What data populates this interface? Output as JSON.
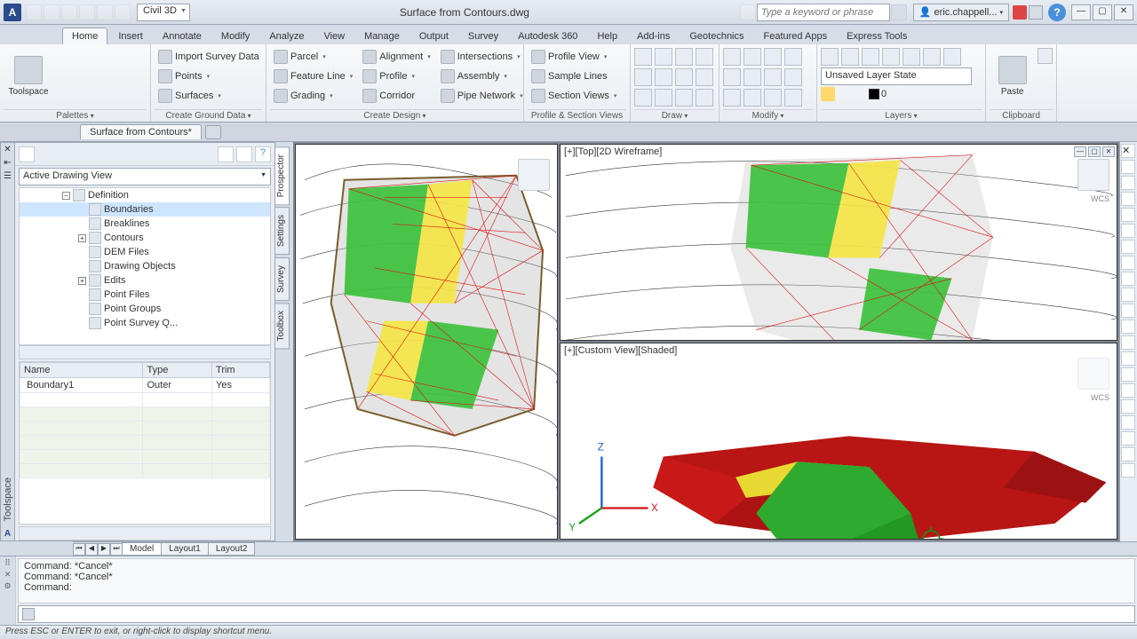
{
  "app": {
    "icon_letter": "A",
    "workspace": "Civil 3D",
    "title": "Surface from Contours.dwg",
    "search_placeholder": "Type a keyword or phrase",
    "user": "eric.chappell..."
  },
  "ribbon_tabs": [
    "Home",
    "Insert",
    "Annotate",
    "Modify",
    "Analyze",
    "View",
    "Manage",
    "Output",
    "Survey",
    "Autodesk 360",
    "Help",
    "Add-ins",
    "Geotechnics",
    "Featured Apps",
    "Express Tools"
  ],
  "ribbon_active": "Home",
  "ribbon": {
    "palettes": {
      "title": "Palettes",
      "big": "Toolspace"
    },
    "ground": {
      "title": "Create Ground Data",
      "items": [
        "Import Survey Data",
        "Points",
        "Surfaces"
      ]
    },
    "design": {
      "title": "Create Design",
      "cols": [
        [
          "Parcel",
          "Feature Line",
          "Grading"
        ],
        [
          "Alignment",
          "Profile",
          "Corridor"
        ],
        [
          "Intersections",
          "Assembly",
          "Pipe Network"
        ]
      ]
    },
    "profile": {
      "title": "Profile & Section Views",
      "items": [
        "Profile View",
        "Sample Lines",
        "Section Views"
      ]
    },
    "draw": {
      "title": "Draw"
    },
    "modify": {
      "title": "Modify"
    },
    "layers": {
      "title": "Layers",
      "state": "Unsaved Layer State",
      "current": "0"
    },
    "clipboard": {
      "title": "Clipboard",
      "big": "Paste"
    }
  },
  "filetab": "Surface from Contours*",
  "toolspace": {
    "title": "Toolspace",
    "view": "Active Drawing View",
    "tabs": [
      "Prospector",
      "Settings",
      "Survey",
      "Toolbox"
    ],
    "tree": {
      "root": "Definition",
      "items": [
        "Boundaries",
        "Breaklines",
        "Contours",
        "DEM Files",
        "Drawing Objects",
        "Edits",
        "Point Files",
        "Point Groups",
        "Point Survey Q..."
      ],
      "selected": "Boundaries"
    },
    "grid": {
      "cols": [
        "Name",
        "Type",
        "Trim"
      ],
      "rows": [
        [
          "Boundary1",
          "Outer",
          "Yes"
        ]
      ]
    }
  },
  "viewports": {
    "top": "[+][Top][2D Wireframe]",
    "custom": "[+][Custom View][Shaded]",
    "wcs": "WCS"
  },
  "layouts": {
    "nav": [
      "⏮",
      "◀",
      "▶",
      "⏭"
    ],
    "tabs": [
      "Model",
      "Layout1",
      "Layout2"
    ]
  },
  "cmd": {
    "hist": [
      "Command: *Cancel*",
      "Command: *Cancel*",
      "Command:"
    ],
    "prompt": ""
  },
  "status": "Press ESC or ENTER to exit, or right-click to display shortcut menu."
}
